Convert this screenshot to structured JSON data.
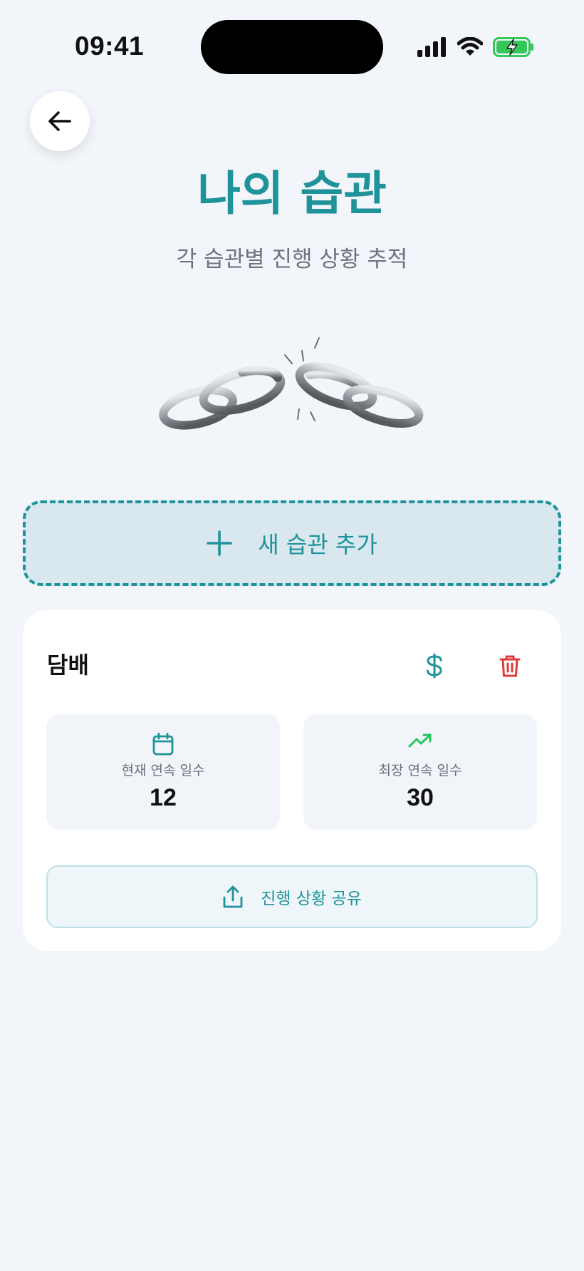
{
  "status_bar": {
    "time": "09:41",
    "icons": [
      "cellular-signal-icon",
      "wifi-icon",
      "battery-charging-icon"
    ]
  },
  "header": {
    "back_icon": "arrow-left-icon",
    "title": "나의 습관",
    "subtitle": "각 습관별 진행 상황 추적"
  },
  "hero_image": "broken-chain",
  "add_habit": {
    "icon": "plus-icon",
    "label": "새 습관 추가"
  },
  "habits": [
    {
      "name": "담배",
      "cost_icon": "dollar-icon",
      "delete_icon": "trash-icon",
      "current_streak": {
        "icon": "calendar-icon",
        "label": "현재 연속 일수",
        "value": "12"
      },
      "longest_streak": {
        "icon": "trending-up-icon",
        "label": "최장 연속 일수",
        "value": "30"
      },
      "share": {
        "icon": "share-icon",
        "label": "진행 상황 공유"
      }
    }
  ],
  "colors": {
    "accent": "#1F939A",
    "delete": "#E03A3A",
    "trend": "#22C55E",
    "battery": "#34C759",
    "background": "#F2F5FA"
  }
}
